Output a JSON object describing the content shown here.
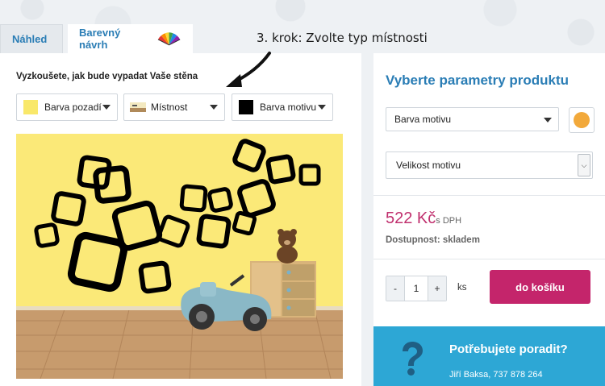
{
  "tabs": [
    {
      "label": "Náhled"
    },
    {
      "label": "Barevný návrh"
    }
  ],
  "step_caption": "3. krok: Zvolte typ místnosti",
  "editor": {
    "instruction": "Vyzkoušete, jak bude vypadat Vaše stěna",
    "controls": {
      "background_color": {
        "label": "Barva pozadí",
        "swatch": "#f9e86a"
      },
      "room": {
        "label": "Místnost"
      },
      "motif_color": {
        "label": "Barva motivu",
        "swatch": "#000000"
      }
    },
    "wall_color": "#fbe978"
  },
  "product": {
    "title": "Vyberte parametry produktu",
    "motif_color_select": "Barva motivu",
    "motif_color_dot": "#f2a93b",
    "size_select": "Velikost motivu",
    "price": "522 Kč",
    "price_suffix": "s DPH",
    "availability": "Dostupnost: skladem",
    "quantity": "1",
    "qty_minus": "-",
    "qty_plus": "+",
    "qty_unit": "ks",
    "cart_button": "do košíku"
  },
  "help": {
    "title": "Potřebujete poradit?",
    "contact": "Jiří Baksa, 737 878 264"
  },
  "colors": {
    "accent_blue": "#2a7db5",
    "price_pink": "#c0306e",
    "cart_pink": "#c4256b",
    "help_bg": "#2da7d5"
  }
}
